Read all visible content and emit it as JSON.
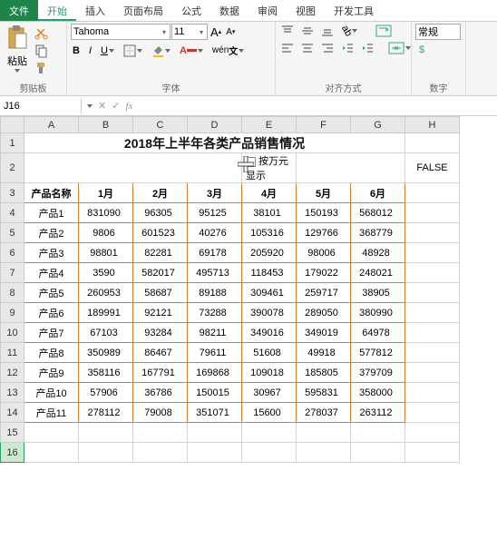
{
  "tabs": {
    "file": "文件",
    "home": "开始",
    "insert": "插入",
    "layout": "页面布局",
    "formula": "公式",
    "data": "数据",
    "review": "审阅",
    "view": "视图",
    "dev": "开发工具"
  },
  "ribbon": {
    "clipboard": {
      "paste": "粘贴",
      "label": "剪贴板"
    },
    "font": {
      "name": "Tahoma",
      "size": "11",
      "label": "字体"
    },
    "align": {
      "label": "对齐方式"
    },
    "number": {
      "style": "常规",
      "label": "数字"
    }
  },
  "namebox": "J16",
  "cols": [
    "A",
    "B",
    "C",
    "D",
    "E",
    "F",
    "G",
    "H"
  ],
  "title": "2018年上半年各类产品销售情况",
  "checkbox_label": "按万元显示",
  "false_text": "FALSE",
  "headers": [
    "产品名称",
    "1月",
    "2月",
    "3月",
    "4月",
    "5月",
    "6月"
  ],
  "rows": [
    {
      "name": "产品1",
      "v": [
        "831090",
        "96305",
        "95125",
        "38101",
        "150193",
        "568012"
      ]
    },
    {
      "name": "产品2",
      "v": [
        "9806",
        "601523",
        "40276",
        "105316",
        "129766",
        "368779"
      ]
    },
    {
      "name": "产品3",
      "v": [
        "98801",
        "82281",
        "69178",
        "205920",
        "98006",
        "48928"
      ]
    },
    {
      "name": "产品4",
      "v": [
        "3590",
        "582017",
        "495713",
        "118453",
        "179022",
        "248021"
      ]
    },
    {
      "name": "产品5",
      "v": [
        "260953",
        "58687",
        "89188",
        "309461",
        "259717",
        "38905"
      ]
    },
    {
      "name": "产品6",
      "v": [
        "189991",
        "92121",
        "73288",
        "390078",
        "289050",
        "380990"
      ]
    },
    {
      "name": "产品7",
      "v": [
        "67103",
        "93284",
        "98211",
        "349016",
        "349019",
        "64978"
      ]
    },
    {
      "name": "产品8",
      "v": [
        "350989",
        "86467",
        "79611",
        "51608",
        "49918",
        "577812"
      ]
    },
    {
      "name": "产品9",
      "v": [
        "358116",
        "167791",
        "169868",
        "109018",
        "185805",
        "379709"
      ]
    },
    {
      "name": "产品10",
      "v": [
        "57906",
        "36786",
        "150015",
        "30967",
        "595831",
        "358000"
      ]
    },
    {
      "name": "产品11",
      "v": [
        "278112",
        "79008",
        "351071",
        "15600",
        "278037",
        "263112"
      ]
    }
  ],
  "active_row": "16"
}
